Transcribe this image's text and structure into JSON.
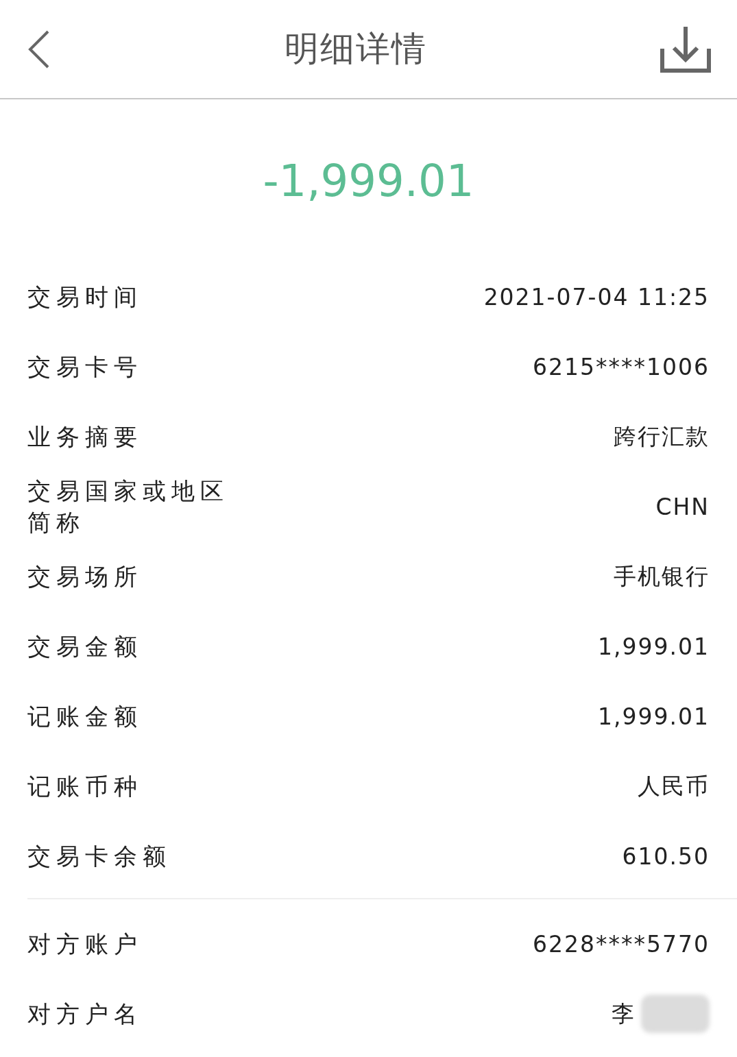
{
  "header": {
    "title": "明细详情"
  },
  "amount": "-1,999.01",
  "details": [
    {
      "label": "交易时间",
      "value": "2021-07-04 11:25"
    },
    {
      "label": "交易卡号",
      "value": "6215****1006"
    },
    {
      "label": "业务摘要",
      "value": "跨行汇款"
    },
    {
      "label": "交易国家或地区简称",
      "value": "CHN"
    },
    {
      "label": "交易场所",
      "value": "手机银行"
    },
    {
      "label": "交易金额",
      "value": "1,999.01"
    },
    {
      "label": "记账金额",
      "value": "1,999.01"
    },
    {
      "label": "记账币种",
      "value": "人民币"
    },
    {
      "label": "交易卡余额",
      "value": "610.50"
    }
  ],
  "counterparty": [
    {
      "label": "对方账户",
      "value": "6228****5770",
      "redacted": false
    },
    {
      "label": "对方户名",
      "value": "李",
      "redacted": true
    }
  ]
}
